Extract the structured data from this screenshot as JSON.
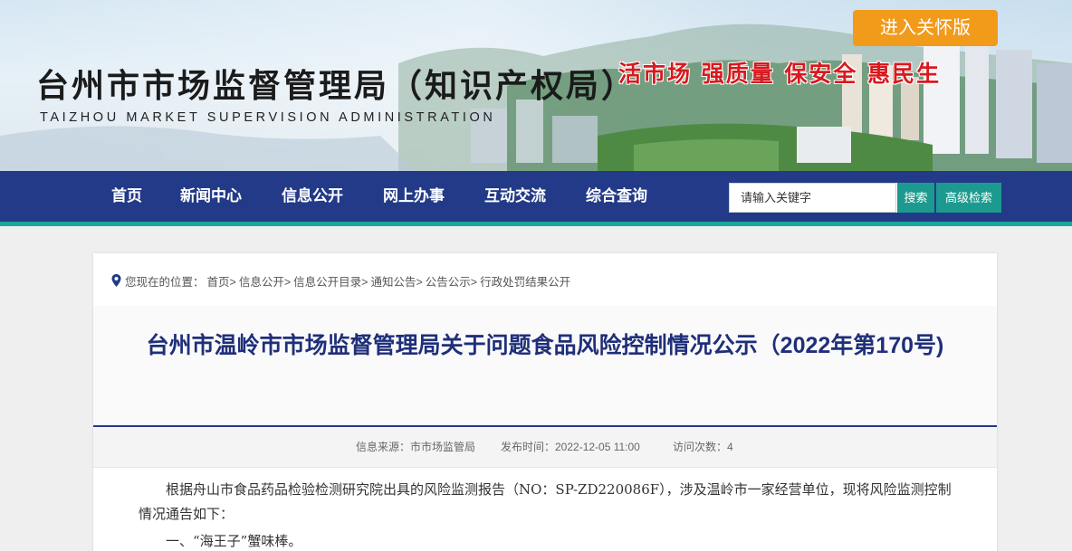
{
  "header": {
    "title": "台州市市场监督管理局（知识产权局）",
    "subtitle": "TAIZHOU MARKET SUPERVISION ADMINISTRATION",
    "slogan": "活市场  强质量  保安全  惠民生",
    "care_button": "进入关怀版"
  },
  "nav": {
    "items": [
      {
        "label": "首页"
      },
      {
        "label": "新闻中心"
      },
      {
        "label": "信息公开"
      },
      {
        "label": "网上办事"
      },
      {
        "label": "互动交流"
      },
      {
        "label": "综合查询"
      }
    ],
    "search_placeholder": "请输入关键字",
    "search_button": "搜索",
    "advanced_button": "高级检索"
  },
  "breadcrumb": {
    "prefix": "您现在的位置：",
    "items": [
      "首页>",
      "信息公开>",
      "信息公开目录>",
      "通知公告>",
      "公告公示>",
      "行政处罚结果公开"
    ]
  },
  "article": {
    "title": "台州市温岭市市场监督管理局关于问题食品风险控制情况公示（2022年第170号)",
    "source": "信息来源：市市场监管局",
    "published": "发布时间：2022-12-05 11:00",
    "views": "访问次数：4",
    "paragraph1": "根据舟山市食品药品检验检测研究院出具的风险监测报告（NO：SP-ZD220086F），涉及温岭市一家经营单位，现将风险监测控制情况通告如下：",
    "item1": "一、“海王子”蟹味棒。"
  },
  "colors": {
    "nav_bg": "#223a87",
    "accent_teal": "#1d9a8f",
    "care_orange": "#f29a1a",
    "slogan_red": "#d8191f",
    "title_blue": "#1f2f7a"
  }
}
